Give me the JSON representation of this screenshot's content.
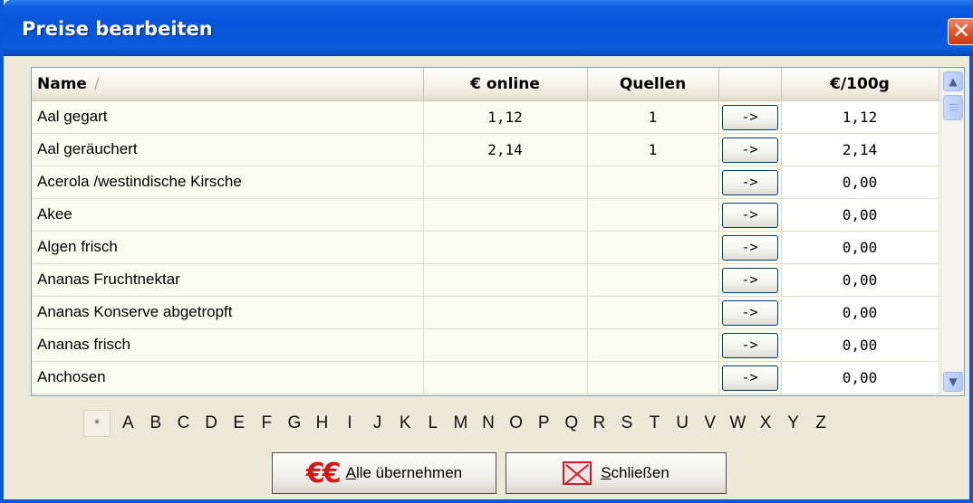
{
  "window": {
    "title": "Preise bearbeiten",
    "close_glyph": "✕"
  },
  "grid": {
    "columns": [
      "Name",
      "€ online",
      "Quellen",
      "",
      "€/100g"
    ],
    "sort_indicator": "/",
    "rows": [
      {
        "name": "Aal gegart",
        "online": "1,12",
        "sources": "1",
        "action": "->",
        "per100g": "1,12"
      },
      {
        "name": "Aal geräuchert",
        "online": "2,14",
        "sources": "1",
        "action": "->",
        "per100g": "2,14"
      },
      {
        "name": "Acerola /westindische Kirsche",
        "online": "",
        "sources": "",
        "action": "->",
        "per100g": "0,00"
      },
      {
        "name": "Akee",
        "online": "",
        "sources": "",
        "action": "->",
        "per100g": "0,00"
      },
      {
        "name": "Algen frisch",
        "online": "",
        "sources": "",
        "action": "->",
        "per100g": "0,00"
      },
      {
        "name": "Ananas Fruchtnektar",
        "online": "",
        "sources": "",
        "action": "->",
        "per100g": "0,00"
      },
      {
        "name": "Ananas Konserve abgetropft",
        "online": "",
        "sources": "",
        "action": "->",
        "per100g": "0,00"
      },
      {
        "name": "Ananas frisch",
        "online": "",
        "sources": "",
        "action": "->",
        "per100g": "0,00"
      },
      {
        "name": "Anchosen",
        "online": "",
        "sources": "",
        "action": "->",
        "per100g": "0,00"
      }
    ]
  },
  "scrollbar": {
    "up_glyph": "▲",
    "down_glyph": "▼"
  },
  "alphabet": {
    "all_label": "*",
    "letters": [
      "A",
      "B",
      "C",
      "D",
      "E",
      "F",
      "G",
      "H",
      "I",
      "J",
      "K",
      "L",
      "M",
      "N",
      "O",
      "P",
      "Q",
      "R",
      "S",
      "T",
      "U",
      "V",
      "W",
      "X",
      "Y",
      "Z"
    ]
  },
  "buttons": {
    "apply_icon": "€€",
    "apply_access_key": "A",
    "apply_rest": "lle übernehmen",
    "close_access_key": "S",
    "close_rest": "chließen"
  },
  "colors": {
    "titlebar": "#0754d8",
    "accent_red": "#d41818",
    "row_background": "#fbfdf0"
  }
}
